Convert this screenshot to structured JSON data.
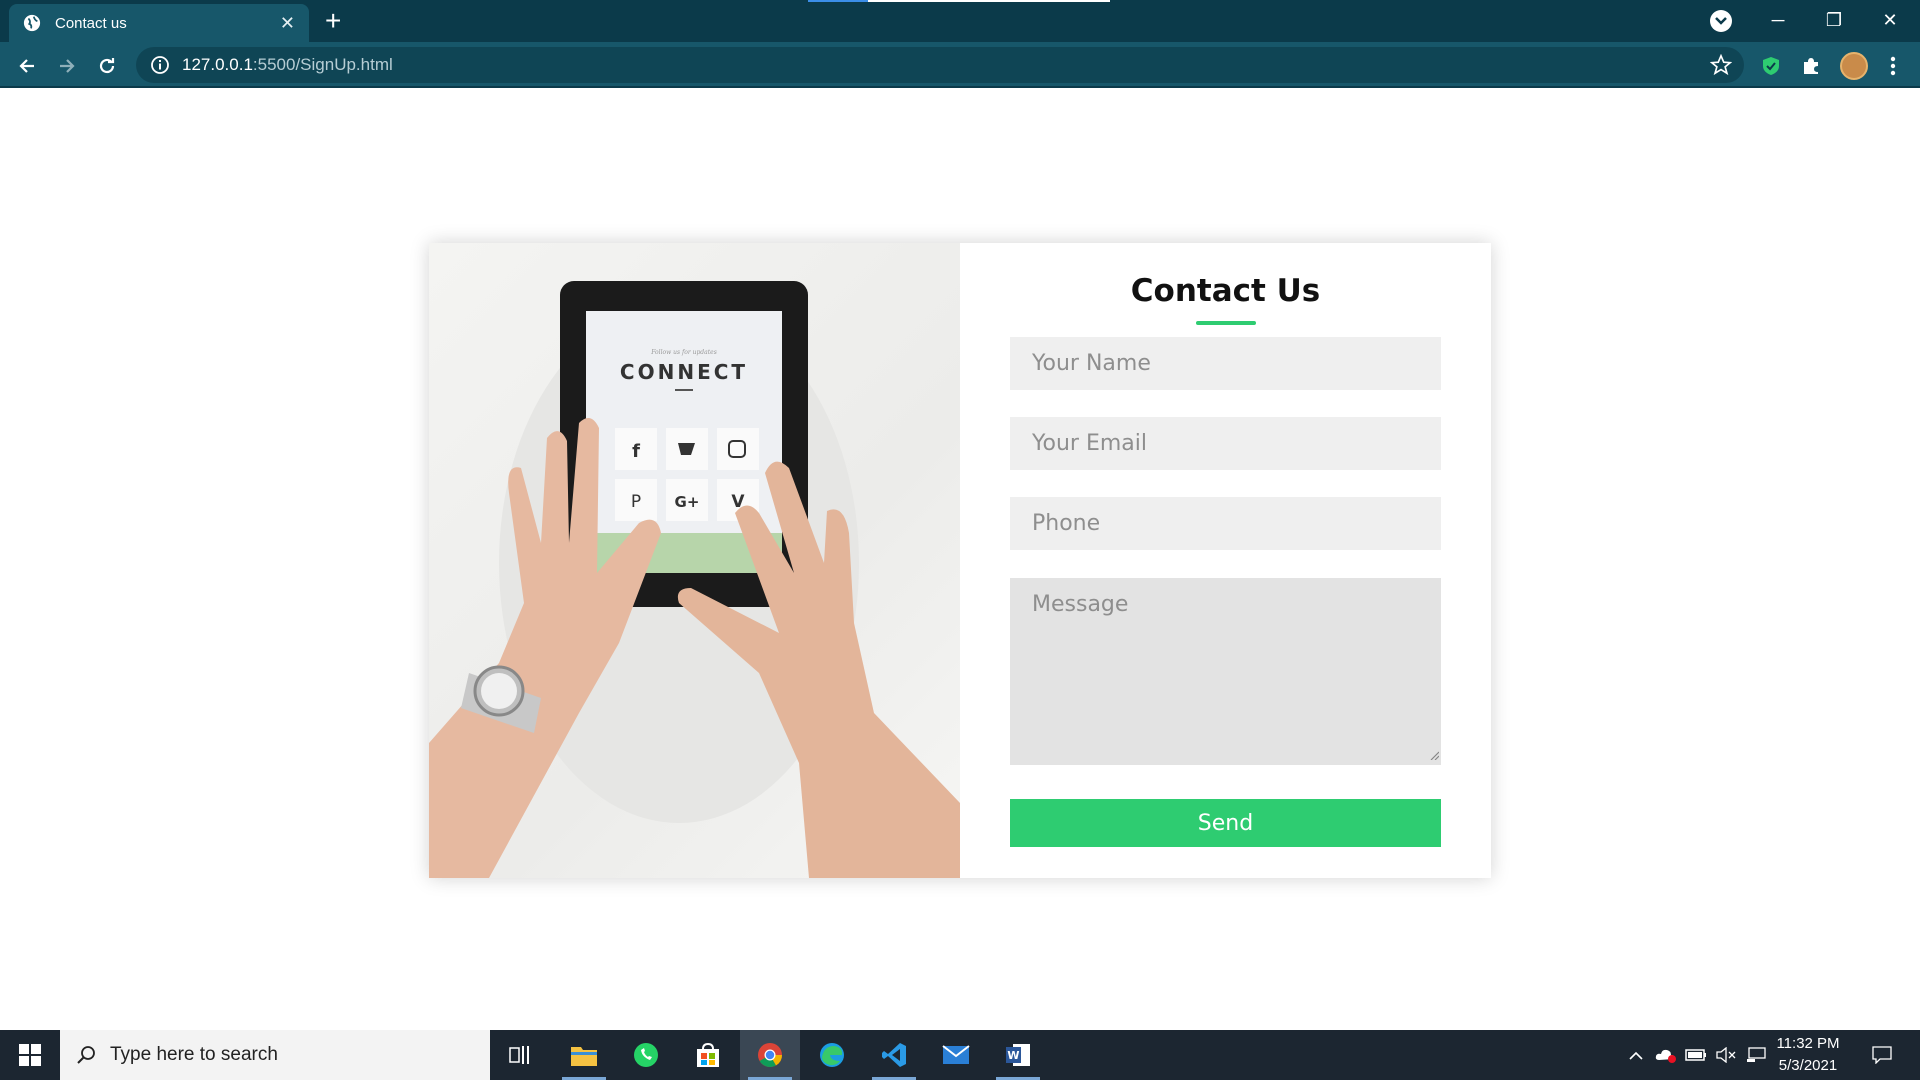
{
  "browser": {
    "tab_title": "Contact us",
    "new_tab": "+",
    "url_host": "127.0.0.1",
    "url_path": ":5500/SignUp.html",
    "minimize": "─",
    "maximize": "❐",
    "close": "✕",
    "tab_close": "✕"
  },
  "contact": {
    "title": "Contact Us",
    "name_placeholder": "Your Name",
    "email_placeholder": "Your Email",
    "phone_placeholder": "Phone",
    "message_placeholder": "Message",
    "send_label": "Send"
  },
  "photo": {
    "tablet_heading": "CONNECT",
    "tablet_subheading": "Follow us for updates"
  },
  "taskbar": {
    "search_placeholder": "Type here to search",
    "time": "11:32 PM",
    "date": "5/3/2021"
  },
  "colors": {
    "accent": "#2ecc71",
    "chrome": "#17576a",
    "chrome_dark": "#0b3a4a",
    "taskbar": "#1c2631"
  }
}
